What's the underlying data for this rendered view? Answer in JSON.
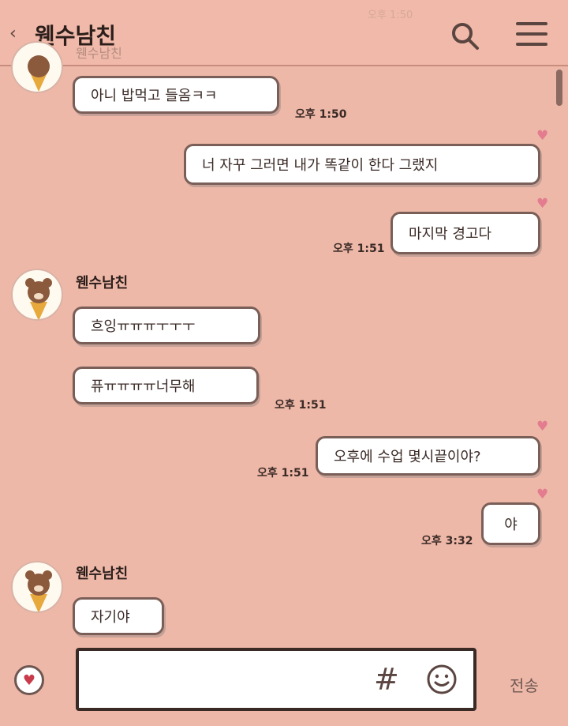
{
  "header": {
    "back_icon": "chevron-left-icon",
    "title": "웬수남친",
    "search_icon": "search-icon",
    "menu_icon": "hamburger-menu-icon"
  },
  "faded": {
    "top_time": "오후 1:50",
    "top_name": "웬수남친"
  },
  "messages": [
    {
      "side": "in",
      "text": "아니 밥먹고 들옴ㅋㅋ",
      "time": "오후 1:50"
    },
    {
      "side": "out",
      "text": "너 자꾸 그러면 내가 똑같이 한다 그랬지"
    },
    {
      "side": "out",
      "text": "마지막 경고다",
      "time": "오후 1:51"
    },
    {
      "side": "in",
      "sender": "웬수남친",
      "text": "흐잉ㅠㅠㅠㅜㅜㅜ"
    },
    {
      "side": "in",
      "text": "퓨ㅠㅠㅠㅠ너무해",
      "time": "오후 1:51"
    },
    {
      "side": "out",
      "text": "오후에 수업 몇시끝이야?",
      "time": "오후 1:51"
    },
    {
      "side": "out",
      "text": "야",
      "time": "오후 3:32"
    },
    {
      "side": "in",
      "sender": "웬수남친",
      "text": "자기야"
    }
  ],
  "input": {
    "heart_icon": "heart-icon",
    "hash_symbol": "#",
    "emoji_icon": "smile-icon",
    "send_label": "전송"
  },
  "colors": {
    "background": "#eeb8a8",
    "bubble": "#ffffff",
    "bubble_border": "#7a5f58",
    "heart": "#e27c8e"
  }
}
